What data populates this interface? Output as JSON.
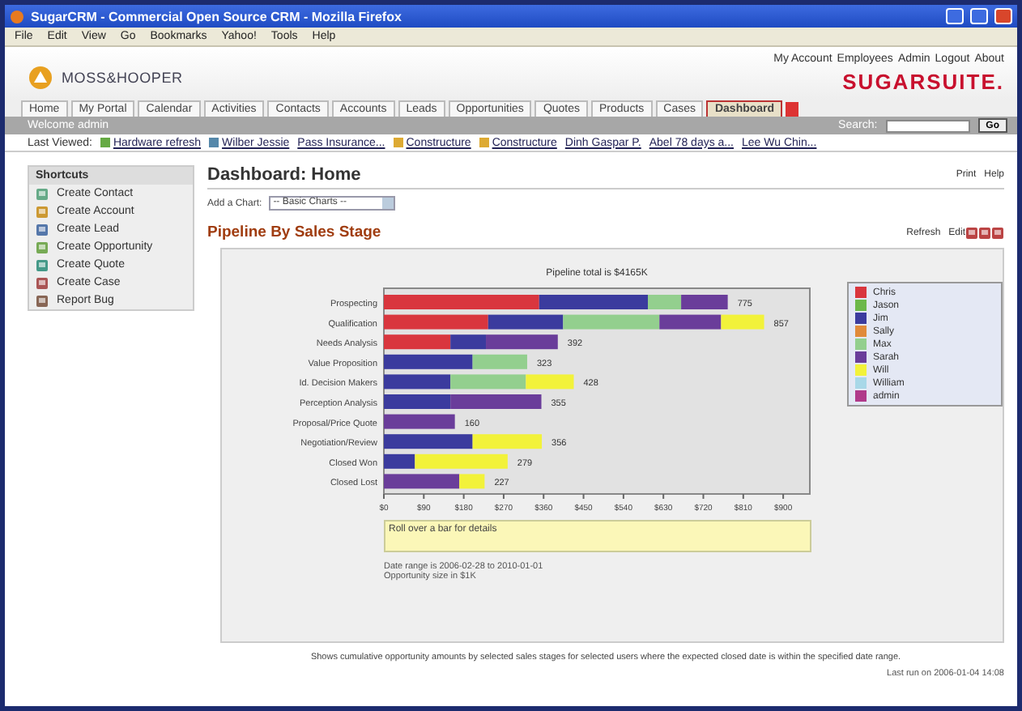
{
  "window": {
    "title": "SugarCRM - Commercial Open Source CRM - Mozilla Firefox"
  },
  "menu": [
    "File",
    "Edit",
    "View",
    "Go",
    "Bookmarks",
    "Yahoo!",
    "Tools",
    "Help"
  ],
  "header": {
    "logo": "MOSS&HOOPER",
    "links": [
      "My Account",
      "Employees",
      "Admin",
      "Logout",
      "About"
    ],
    "brand": "SUGARSUITE",
    "brand_dot": "."
  },
  "tabs": [
    {
      "label": "Home",
      "selected": false
    },
    {
      "label": "My Portal",
      "selected": false
    },
    {
      "label": "Calendar",
      "selected": false
    },
    {
      "label": "Activities",
      "selected": false
    },
    {
      "label": "Contacts",
      "selected": false
    },
    {
      "label": "Accounts",
      "selected": false
    },
    {
      "label": "Leads",
      "selected": false
    },
    {
      "label": "Opportunities",
      "selected": false
    },
    {
      "label": "Quotes",
      "selected": false
    },
    {
      "label": "Products",
      "selected": false
    },
    {
      "label": "Cases",
      "selected": false
    },
    {
      "label": "Dashboard",
      "selected": true
    }
  ],
  "welcome": "Welcome admin",
  "search": {
    "label": "Search:",
    "button": "Go"
  },
  "last_viewed": {
    "label": "Last Viewed:",
    "items": [
      {
        "label": "Hardware refresh",
        "kind": "opportunity"
      },
      {
        "label": "Wilber Jessie",
        "kind": "contact"
      },
      {
        "label": "Pass Insurance...",
        "kind": "plain"
      },
      {
        "label": "Constructure",
        "kind": "account"
      },
      {
        "label": "Constructure",
        "kind": "account"
      },
      {
        "label": "Dinh Gaspar P.",
        "kind": "plain"
      },
      {
        "label": "Abel 78 days a...",
        "kind": "plain"
      },
      {
        "label": "Lee Wu Chin...",
        "kind": "plain"
      }
    ]
  },
  "shortcuts": {
    "title": "Shortcuts",
    "items": [
      "Create Contact",
      "Create Account",
      "Create Lead",
      "Create Opportunity",
      "Create Quote",
      "Create Case",
      "Report Bug"
    ]
  },
  "page_title": "Dashboard: Home",
  "page_actions": [
    "Print",
    "Help"
  ],
  "add_chart": {
    "label": "Add a Chart:",
    "value": "-- Basic Charts --"
  },
  "chart_panel": {
    "title": "Pipeline By Sales Stage",
    "actions": [
      "Refresh",
      "Edit"
    ],
    "chart_data": {
      "type": "bar",
      "orientation": "horizontal",
      "stacked": true,
      "title": "Pipeline total is $4165K",
      "categories": [
        "Prospecting",
        "Qualification",
        "Needs Analysis",
        "Value Proposition",
        "Id. Decision Makers",
        "Perception Analysis",
        "Proposal/Price Quote",
        "Negotiation/Review",
        "Closed Won",
        "Closed Lost"
      ],
      "series": [
        {
          "name": "Chris",
          "color": "#d9363e",
          "values": [
            350,
            235,
            150,
            null,
            null,
            null,
            null,
            null,
            null,
            null
          ]
        },
        {
          "name": "Jason",
          "color": "#6cb84a",
          "values": [
            null,
            null,
            null,
            null,
            null,
            null,
            null,
            null,
            null,
            null
          ]
        },
        {
          "name": "Jim",
          "color": "#3b3b9e",
          "values": [
            245,
            169,
            80,
            200,
            150,
            150,
            null,
            200,
            70,
            null
          ]
        },
        {
          "name": "Sally",
          "color": "#e08a3a",
          "values": [
            null,
            null,
            null,
            null,
            null,
            null,
            null,
            null,
            null,
            null
          ]
        },
        {
          "name": "Max",
          "color": "#93cf8e",
          "values": [
            75,
            217,
            null,
            123,
            170,
            null,
            null,
            null,
            null,
            null
          ]
        },
        {
          "name": "Sarah",
          "color": "#6a3d9a",
          "values": [
            105,
            139,
            162,
            null,
            null,
            205,
            160,
            null,
            null,
            170
          ]
        },
        {
          "name": "Will",
          "color": "#f2f23a",
          "values": [
            null,
            97,
            null,
            null,
            108,
            null,
            null,
            156,
            209,
            57
          ]
        },
        {
          "name": "William",
          "color": "#a8d8e8",
          "values": [
            null,
            null,
            null,
            null,
            null,
            null,
            null,
            null,
            null,
            null
          ]
        },
        {
          "name": "admin",
          "color": "#b03a8a",
          "values": [
            null,
            null,
            null,
            null,
            null,
            null,
            null,
            null,
            null,
            null
          ]
        }
      ],
      "value_labels": [
        "775",
        "857",
        "392",
        "323",
        "428",
        "355",
        "160",
        "356",
        "279",
        "227"
      ],
      "xlim": [
        0,
        960
      ],
      "xticks": [
        {
          "value": 0,
          "label": "$0"
        },
        {
          "value": 90,
          "label": "$90"
        },
        {
          "value": 180,
          "label": "$180"
        },
        {
          "value": 270,
          "label": "$270"
        },
        {
          "value": 360,
          "label": "$360"
        },
        {
          "value": 450,
          "label": "$450"
        },
        {
          "value": 540,
          "label": "$540"
        },
        {
          "value": 630,
          "label": "$630"
        },
        {
          "value": 720,
          "label": "$720"
        },
        {
          "value": 810,
          "label": "$810"
        },
        {
          "value": 900,
          "label": "$900"
        }
      ]
    },
    "details_hint": "Roll over a bar for details",
    "notes": [
      "Date range is 2006-02-28 to 2010-01-01",
      "Opportunity size in $1K"
    ],
    "description": "Shows cumulative opportunity amounts by selected sales stages for selected users where the expected closed date is within the specified date range.",
    "last_run": "Last run on 2006-01-04 14:08"
  }
}
